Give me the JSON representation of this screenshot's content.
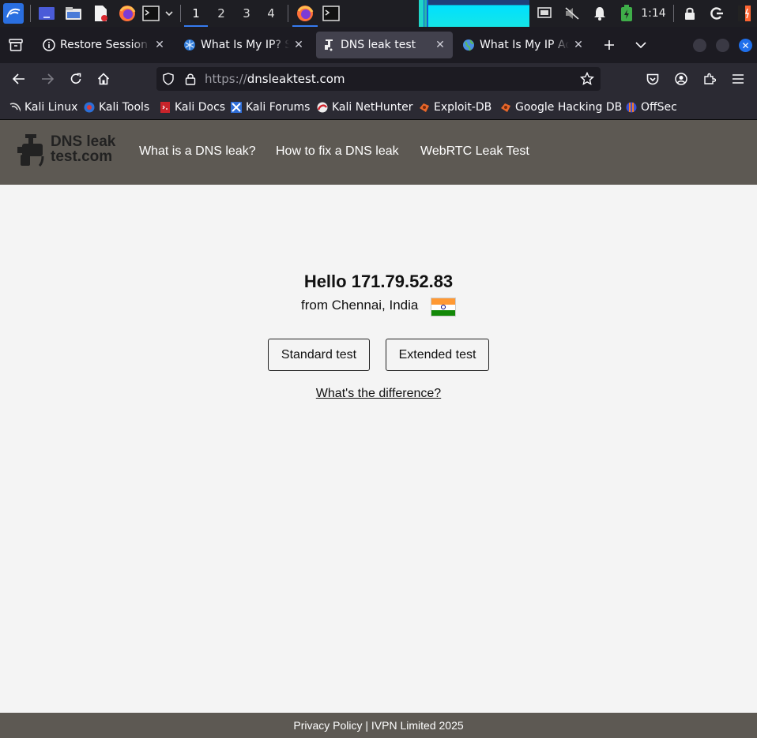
{
  "taskbar": {
    "workspaces": [
      "1",
      "2",
      "3",
      "4"
    ],
    "active_workspace": "1",
    "clock": "1:14"
  },
  "tabs": [
    {
      "label": "Restore Session",
      "icon": "info-icon",
      "active": false
    },
    {
      "label": "What Is My IP? Sec",
      "icon": "snowflake-globe-icon",
      "active": false
    },
    {
      "label": "DNS leak test",
      "icon": "faucet-icon",
      "active": true
    },
    {
      "label": "What Is My IP Addr",
      "icon": "globe-icon",
      "active": false
    }
  ],
  "toolbar": {
    "url_scheme": "https://",
    "url_host": "dnsleaktest.com"
  },
  "bookmarks": [
    {
      "label": "Kali Linux",
      "icon": "kali-dragon-icon"
    },
    {
      "label": "Kali Tools",
      "icon": "kali-tools-icon"
    },
    {
      "label": "Kali Docs",
      "icon": "kali-docs-icon"
    },
    {
      "label": "Kali Forums",
      "icon": "kali-forums-icon"
    },
    {
      "label": "Kali NetHunter",
      "icon": "nethunter-icon"
    },
    {
      "label": "Exploit-DB",
      "icon": "exploit-db-icon"
    },
    {
      "label": "Google Hacking DB",
      "icon": "ghdb-icon"
    },
    {
      "label": "OffSec",
      "icon": "offsec-icon"
    }
  ],
  "site": {
    "logo_line1": "DNS leak",
    "logo_line2": "test.com",
    "nav": [
      "What is a DNS leak?",
      "How to fix a DNS leak",
      "WebRTC Leak Test"
    ],
    "greeting": "Hello 171.79.52.83",
    "location": "from Chennai, India",
    "standard_button": "Standard test",
    "extended_button": "Extended test",
    "difference_link": "What's the difference?",
    "footer": "Privacy Policy | IVPN Limited 2025"
  },
  "colors": {
    "header_bg": "#5d5953",
    "page_bg": "#f4f4f4",
    "accent": "#367bf0"
  }
}
